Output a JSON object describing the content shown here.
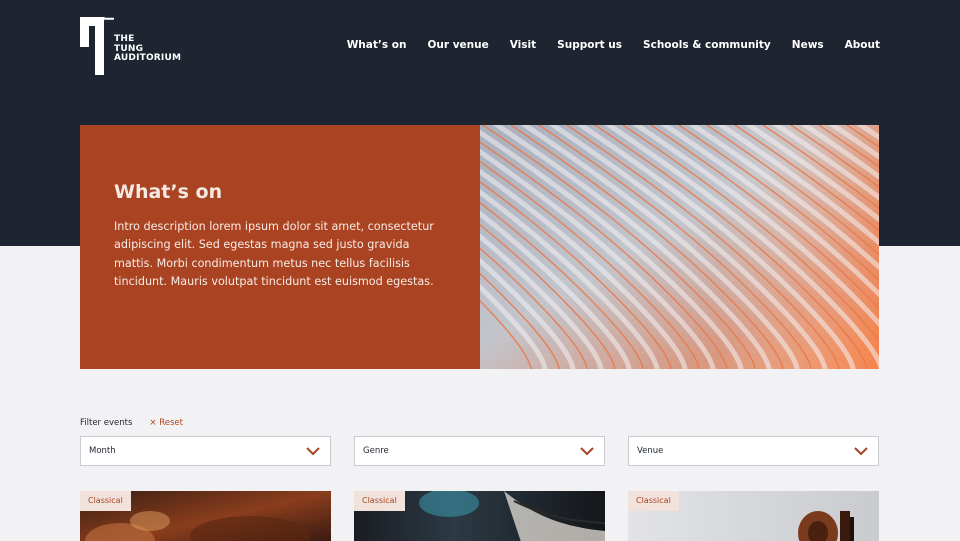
{
  "logo": {
    "line1": "THE",
    "line2": "TUNG",
    "line3": "AUDITORIUM"
  },
  "nav": {
    "items": [
      {
        "label": "What’s on"
      },
      {
        "label": "Our venue"
      },
      {
        "label": "Visit"
      },
      {
        "label": "Support us"
      },
      {
        "label": "Schools & community"
      },
      {
        "label": "News"
      },
      {
        "label": "About"
      }
    ]
  },
  "hero": {
    "title": "What’s on",
    "description": "Intro description lorem ipsum dolor sit amet, consectetur adipiscing elit. Sed egestas magna sed justo gravida mattis. Morbi condimentum metus nec tellus facilisis tincidunt. Mauris volutpat tincidunt est euismod egestas."
  },
  "filters": {
    "label": "Filter events",
    "reset": "× Reset",
    "selects": [
      {
        "value": "Month"
      },
      {
        "value": "Genre"
      },
      {
        "value": "Venue"
      }
    ]
  },
  "cards": [
    {
      "tag": "Classical"
    },
    {
      "tag": "Classical"
    },
    {
      "tag": "Classical"
    }
  ],
  "colors": {
    "navy": "#1e2530",
    "rust": "#aa4321",
    "background": "#f2f2f4"
  }
}
